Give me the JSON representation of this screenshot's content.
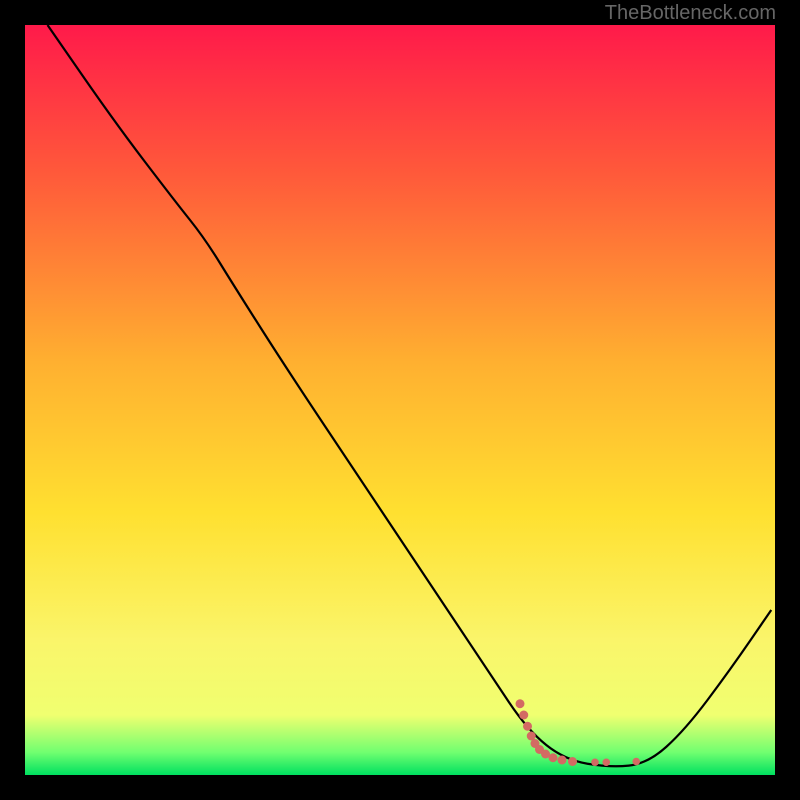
{
  "watermark": "TheBottleneck.com",
  "chart_data": {
    "type": "line",
    "title": "",
    "xlabel": "",
    "ylabel": "",
    "xlim": [
      0,
      100
    ],
    "ylim": [
      0,
      100
    ],
    "gradient_stops": [
      {
        "offset": 0.0,
        "color": "#ff1a4a"
      },
      {
        "offset": 0.2,
        "color": "#ff5a3a"
      },
      {
        "offset": 0.45,
        "color": "#ffb030"
      },
      {
        "offset": 0.65,
        "color": "#ffe030"
      },
      {
        "offset": 0.82,
        "color": "#faf56a"
      },
      {
        "offset": 0.92,
        "color": "#f0ff70"
      },
      {
        "offset": 0.97,
        "color": "#70ff70"
      },
      {
        "offset": 1.0,
        "color": "#00e060"
      }
    ],
    "series": [
      {
        "name": "curve",
        "stroke": "#000000",
        "stroke_width": 2.2,
        "points": [
          {
            "x": 3.0,
            "y": 100.0
          },
          {
            "x": 12.0,
            "y": 87.0
          },
          {
            "x": 20.0,
            "y": 76.5
          },
          {
            "x": 24.0,
            "y": 71.5
          },
          {
            "x": 28.0,
            "y": 65.0
          },
          {
            "x": 35.0,
            "y": 54.0
          },
          {
            "x": 45.0,
            "y": 39.0
          },
          {
            "x": 55.0,
            "y": 24.0
          },
          {
            "x": 62.0,
            "y": 13.5
          },
          {
            "x": 67.0,
            "y": 6.0
          },
          {
            "x": 72.0,
            "y": 2.0
          },
          {
            "x": 78.0,
            "y": 1.0
          },
          {
            "x": 83.0,
            "y": 1.5
          },
          {
            "x": 88.0,
            "y": 6.0
          },
          {
            "x": 94.0,
            "y": 14.0
          },
          {
            "x": 99.5,
            "y": 22.0
          }
        ]
      }
    ],
    "markers": {
      "name": "highlight-dots",
      "fill": "#d36a63",
      "points": [
        {
          "x": 66.0,
          "y": 9.5,
          "r": 4.5
        },
        {
          "x": 66.5,
          "y": 8.0,
          "r": 4.5
        },
        {
          "x": 67.0,
          "y": 6.5,
          "r": 4.5
        },
        {
          "x": 67.5,
          "y": 5.2,
          "r": 4.5
        },
        {
          "x": 68.0,
          "y": 4.2,
          "r": 4.5
        },
        {
          "x": 68.6,
          "y": 3.4,
          "r": 4.5
        },
        {
          "x": 69.4,
          "y": 2.8,
          "r": 4.5
        },
        {
          "x": 70.4,
          "y": 2.3,
          "r": 4.5
        },
        {
          "x": 71.6,
          "y": 2.0,
          "r": 4.5
        },
        {
          "x": 73.0,
          "y": 1.8,
          "r": 4.5
        },
        {
          "x": 76.0,
          "y": 1.7,
          "r": 3.8
        },
        {
          "x": 77.5,
          "y": 1.7,
          "r": 3.8
        },
        {
          "x": 81.5,
          "y": 1.8,
          "r": 3.8
        }
      ]
    }
  }
}
